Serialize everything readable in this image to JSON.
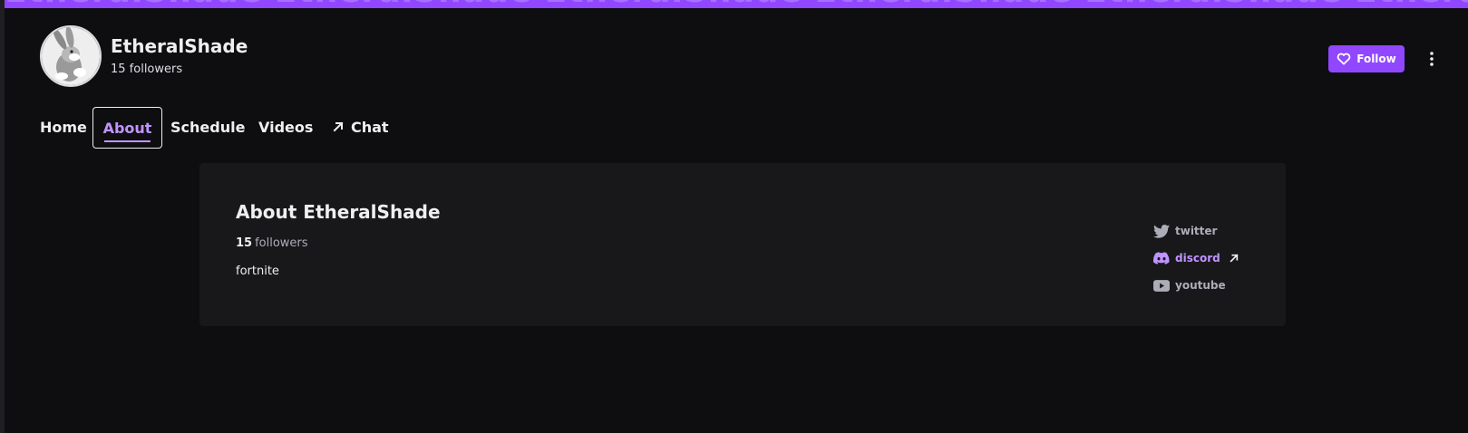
{
  "banner": {
    "text": "EtheralShade EtheralShade EtheralShade EtheralShade EtheralShade EtheralShade"
  },
  "channel": {
    "name": "EtheralShade",
    "followers_text": "15 followers"
  },
  "actions": {
    "follow_label": "Follow"
  },
  "nav": {
    "items": [
      {
        "label": "Home"
      },
      {
        "label": "About",
        "active": true
      },
      {
        "label": "Schedule"
      },
      {
        "label": "Videos"
      },
      {
        "label": "Chat"
      }
    ]
  },
  "about": {
    "title": "About EtheralShade",
    "followers_count": "15",
    "followers_label": "followers",
    "description": "fortnite",
    "social_links": [
      {
        "label": "twitter",
        "icon": "twitter-icon"
      },
      {
        "label": "discord",
        "icon": "discord-icon",
        "highlight": true
      },
      {
        "label": "youtube",
        "icon": "youtube-icon"
      }
    ]
  },
  "colors": {
    "accent": "#9147ff",
    "accent_light": "#bf94ff",
    "background": "#0e0e10",
    "panel": "#18181b"
  }
}
